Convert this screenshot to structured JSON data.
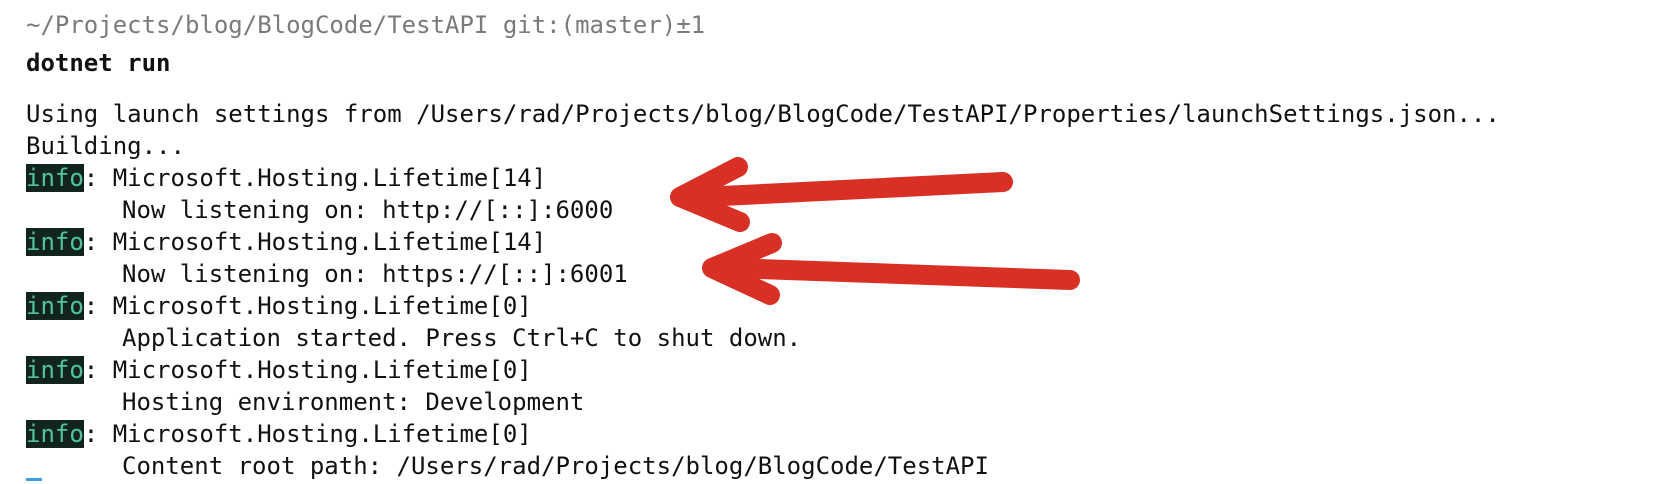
{
  "terminal": {
    "prompt": "~/Projects/blog/BlogCode/TestAPI git:(master)±1",
    "command": "dotnet run",
    "lines": [
      {
        "kind": "plain",
        "text": "Using launch settings from /Users/rad/Projects/blog/BlogCode/TestAPI/Properties/launchSettings.json..."
      },
      {
        "kind": "plain",
        "text": "Building..."
      },
      {
        "kind": "log",
        "tag": "info",
        "text": ": Microsoft.Hosting.Lifetime[14]"
      },
      {
        "kind": "detail",
        "text": "Now listening on: http://[::]:6000"
      },
      {
        "kind": "log",
        "tag": "info",
        "text": ": Microsoft.Hosting.Lifetime[14]"
      },
      {
        "kind": "detail",
        "text": "Now listening on: https://[::]:6001"
      },
      {
        "kind": "log",
        "tag": "info",
        "text": ": Microsoft.Hosting.Lifetime[0]"
      },
      {
        "kind": "detail",
        "text": "Application started. Press Ctrl+C to shut down."
      },
      {
        "kind": "log",
        "tag": "info",
        "text": ": Microsoft.Hosting.Lifetime[0]"
      },
      {
        "kind": "detail",
        "text": "Hosting environment: Development"
      },
      {
        "kind": "log",
        "tag": "info",
        "text": ": Microsoft.Hosting.Lifetime[0]"
      },
      {
        "kind": "detail",
        "text": "Content root path: /Users/rad/Projects/blog/BlogCode/TestAPI"
      }
    ]
  },
  "colors": {
    "arrow": "#d93025",
    "tag_bg": "#12241f",
    "tag_fg": "#52c49a",
    "prompt": "#7a7a7a",
    "cursor": "#3aa0e0"
  },
  "annotations": {
    "arrow_icon": "red-arrow-icon"
  }
}
